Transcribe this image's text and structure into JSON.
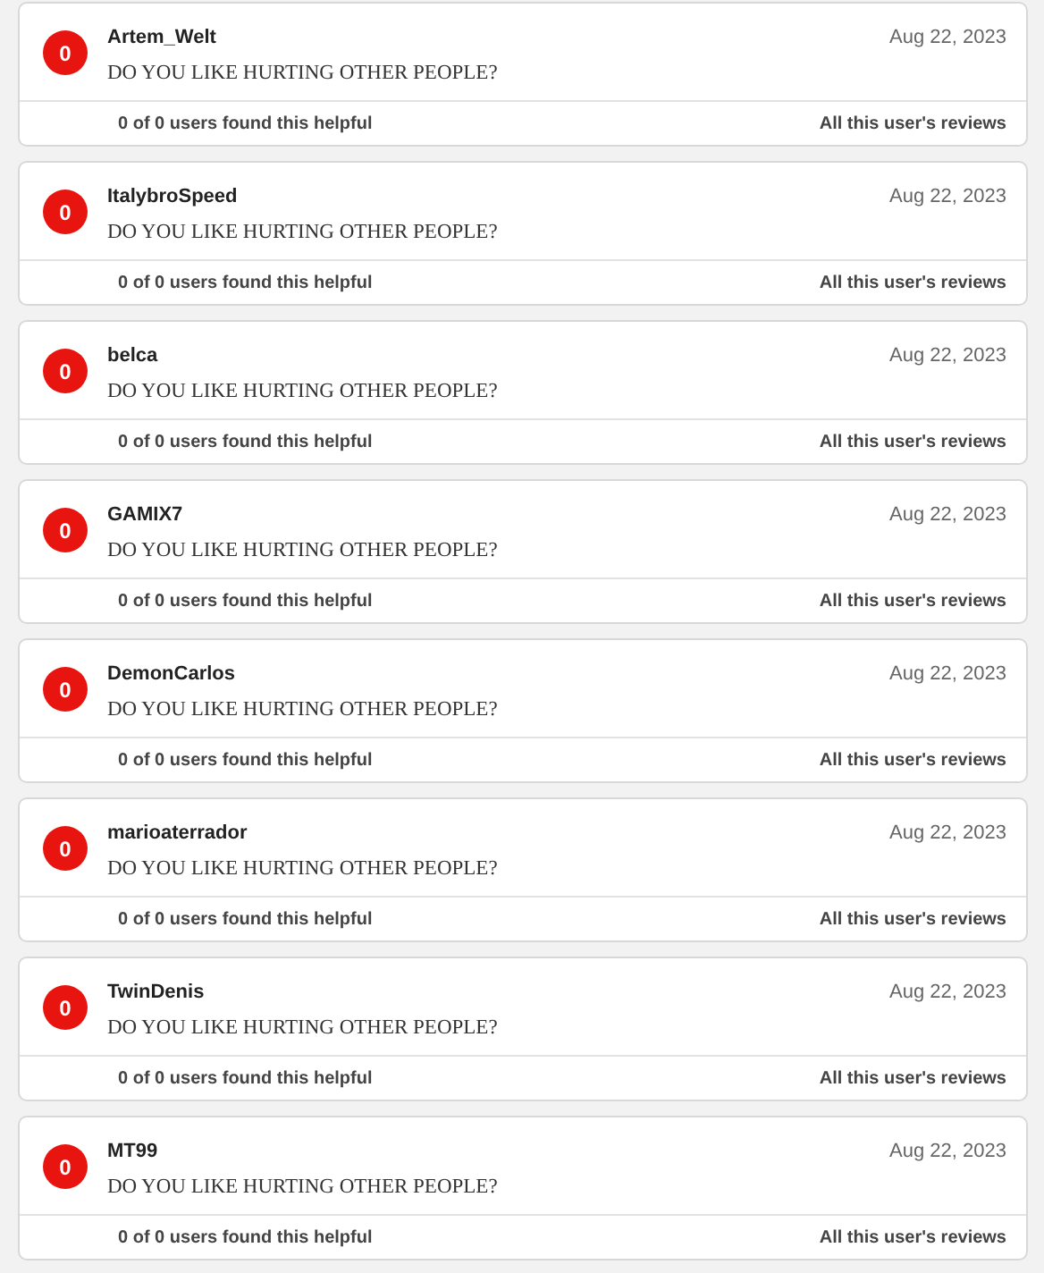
{
  "reviews": [
    {
      "score": "0",
      "user": "Artem_Welt",
      "date": "Aug 22, 2023",
      "text": "DO YOU LIKE HURTING OTHER PEOPLE?",
      "helpful": "0 of 0 users found this helpful",
      "link": "All this user's reviews"
    },
    {
      "score": "0",
      "user": "ItalybroSpeed",
      "date": "Aug 22, 2023",
      "text": "DO YOU LIKE HURTING OTHER PEOPLE?",
      "helpful": "0 of 0 users found this helpful",
      "link": "All this user's reviews"
    },
    {
      "score": "0",
      "user": "belca",
      "date": "Aug 22, 2023",
      "text": "DO YOU LIKE HURTING OTHER PEOPLE?",
      "helpful": "0 of 0 users found this helpful",
      "link": "All this user's reviews"
    },
    {
      "score": "0",
      "user": "GAMIX7",
      "date": "Aug 22, 2023",
      "text": "DO YOU LIKE HURTING OTHER PEOPLE?",
      "helpful": "0 of 0 users found this helpful",
      "link": "All this user's reviews"
    },
    {
      "score": "0",
      "user": "DemonCarlos",
      "date": "Aug 22, 2023",
      "text": "DO YOU LIKE HURTING OTHER PEOPLE?",
      "helpful": "0 of 0 users found this helpful",
      "link": "All this user's reviews"
    },
    {
      "score": "0",
      "user": "marioaterrador",
      "date": "Aug 22, 2023",
      "text": "DO YOU LIKE HURTING OTHER PEOPLE?",
      "helpful": "0 of 0 users found this helpful",
      "link": "All this user's reviews"
    },
    {
      "score": "0",
      "user": "TwinDenis",
      "date": "Aug 22, 2023",
      "text": "DO YOU LIKE HURTING OTHER PEOPLE?",
      "helpful": "0 of 0 users found this helpful",
      "link": "All this user's reviews"
    },
    {
      "score": "0",
      "user": "MT99",
      "date": "Aug 22, 2023",
      "text": "DO YOU LIKE HURTING OTHER PEOPLE?",
      "helpful": "0 of 0 users found this helpful",
      "link": "All this user's reviews"
    }
  ]
}
